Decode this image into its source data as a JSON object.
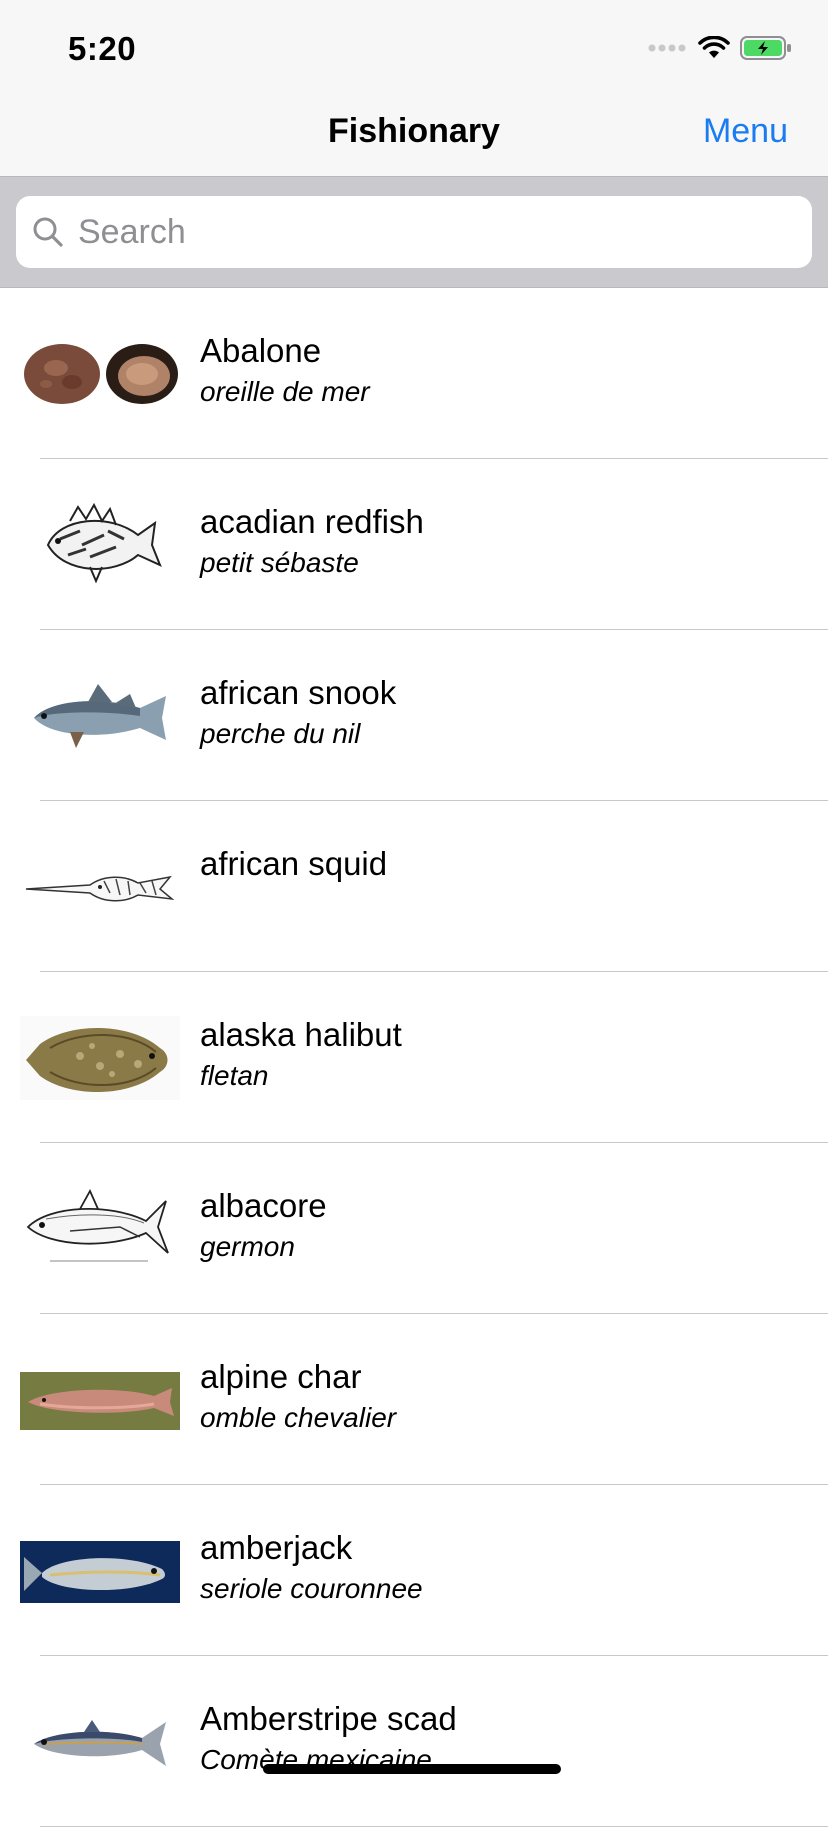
{
  "status_bar": {
    "time": "5:20",
    "icons": [
      "cellular-signal-icon",
      "wifi-icon",
      "battery-charging-icon"
    ],
    "battery_color": "#4cd964"
  },
  "nav": {
    "title": "Fishionary",
    "menu_label": "Menu",
    "accent_color": "#1a7cf0"
  },
  "search": {
    "placeholder": "Search",
    "value": ""
  },
  "items": [
    {
      "name": "Abalone",
      "french": "oreille de mer",
      "thumbnail": "abalone-shell-image"
    },
    {
      "name": "acadian redfish",
      "french": "petit sébaste",
      "thumbnail": "acadian-redfish-drawing"
    },
    {
      "name": "african snook",
      "french": "perche du nil",
      "thumbnail": "african-snook-image"
    },
    {
      "name": "african squid",
      "french": "",
      "thumbnail": "african-squid-drawing"
    },
    {
      "name": "alaska halibut",
      "french": "fletan",
      "thumbnail": "alaska-halibut-image"
    },
    {
      "name": "albacore",
      "french": "germon",
      "thumbnail": "albacore-drawing"
    },
    {
      "name": "alpine char",
      "french": "omble chevalier",
      "thumbnail": "alpine-char-photo"
    },
    {
      "name": "amberjack",
      "french": "seriole couronnee",
      "thumbnail": "amberjack-photo"
    },
    {
      "name": "Amberstripe scad",
      "french": "Comète mexicaine",
      "thumbnail": "amberstripe-scad-image"
    }
  ]
}
